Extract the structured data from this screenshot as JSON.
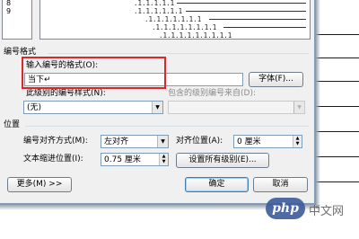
{
  "level_list": {
    "items": [
      "8",
      "9"
    ]
  },
  "preview": {
    "rows": [
      ".1.1.1.1.1",
      ".1.1.1.1.1.1",
      ".1.1.1.1.1.1.1",
      ".1.1.1.1.1.1.1.1",
      ".1.1.1.1.1.1.1.1.1"
    ]
  },
  "numbering_format": {
    "section_label": "编号格式",
    "format_input_label": "输入编号的格式(O):",
    "format_value": "当下↵",
    "font_button": "字体(F)...",
    "style_label": "此级别的编号样式(N):",
    "style_value": "(无)",
    "include_label": "包含的级别编号来自(D):",
    "include_value": ""
  },
  "position": {
    "section_label": "位置",
    "align_label": "编号对齐方式(M):",
    "align_value": "左对齐",
    "align_pos_label": "对齐位置(A):",
    "align_pos_value": "0 厘米",
    "indent_label": "文本缩进位置(I):",
    "indent_value": "0.75 厘米",
    "set_all_button": "设置所有级别(E)..."
  },
  "footer": {
    "more_button": "更多(M) >>",
    "ok_button": "确定",
    "cancel_button": "取消"
  },
  "watermark": {
    "logo_text": "php",
    "site_text": "中文网"
  },
  "colors": {
    "highlight": "#e0242a",
    "dialog_bg": "#f0f0f0"
  }
}
